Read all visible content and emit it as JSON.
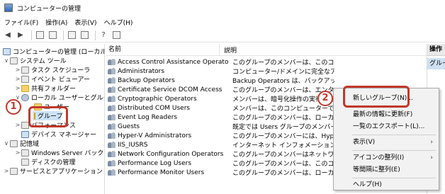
{
  "window": {
    "title": "コンピューターの管理"
  },
  "menu": [
    "ファイル(F)",
    "操作(A)",
    "表示(V)",
    "ヘルプ(H)"
  ],
  "tree": {
    "root": "コンピューターの管理 (ローカル)",
    "system_tools": "システム ツール",
    "task_scheduler": "タスク スケジューラ",
    "event_viewer": "イベント ビューアー",
    "shared_folders": "共有フォルダー",
    "local_users_groups": "ローカル ユーザーとグループ",
    "users_hidden": "ユーザー",
    "groups": "グループ",
    "performance": "パフォーマンス",
    "device_manager": "デバイス マネージャー",
    "storage": "記憶域",
    "windows_server_backup": "Windows Server バックア",
    "disk_management": "ディスクの管理",
    "services_apps": "サービスとアプリケーション"
  },
  "list": {
    "col_name": "名前",
    "col_desc": "説明",
    "rows": [
      {
        "name": "Access Control Assistance Operators",
        "desc": "このグループのメンバーは、このコンピュー..."
      },
      {
        "name": "Administrators",
        "desc": "コンピューター/ドメインに完全なアクセス..."
      },
      {
        "name": "Backup Operators",
        "desc": "Backup Operators は、バックアップの..."
      },
      {
        "name": "Certificate Service DCOM Access",
        "desc": "このグループのメンバーは、エンタープライ..."
      },
      {
        "name": "Cryptographic Operators",
        "desc": "メンバーは、暗号化操作の実行を許..."
      },
      {
        "name": "Distributed COM Users",
        "desc": "メンバーは、このコンピューターで分散 C..."
      },
      {
        "name": "Event Log Readers",
        "desc": "このグループのメンバーは、ローカル コン..."
      },
      {
        "name": "Guests",
        "desc": "既定では Users グループのメンバーと同..."
      },
      {
        "name": "Hyper-V Administrators",
        "desc": "このグループのメンバーには、Hyper-V ..."
      },
      {
        "name": "IIS_IUSRS",
        "desc": "インターネット インフォメーション サービス..."
      },
      {
        "name": "Network Configuration Operators",
        "desc": "このグループのメンバーはネットワーク機..."
      },
      {
        "name": "Performance Log Users",
        "desc": "このグループのメンバーは、このコンピュー..."
      },
      {
        "name": "Performance Monitor Users",
        "desc": "このグループのメンバーは、ローカルやリモ..."
      }
    ]
  },
  "actions": {
    "header": "操作",
    "item": "グループ"
  },
  "context_menu": {
    "new_group": "新しいグループ(N)...",
    "refresh": "最新の情報に更新(F)",
    "export": "一覧のエクスポート(L)...",
    "view": "表示(V)",
    "arrange_icons": "アイコンの整列(I)",
    "line_up": "等間隔に整列(E)",
    "help": "ヘルプ(H)"
  },
  "annotations": {
    "step1": "1",
    "step2": "2",
    "color": "#c0392b"
  }
}
